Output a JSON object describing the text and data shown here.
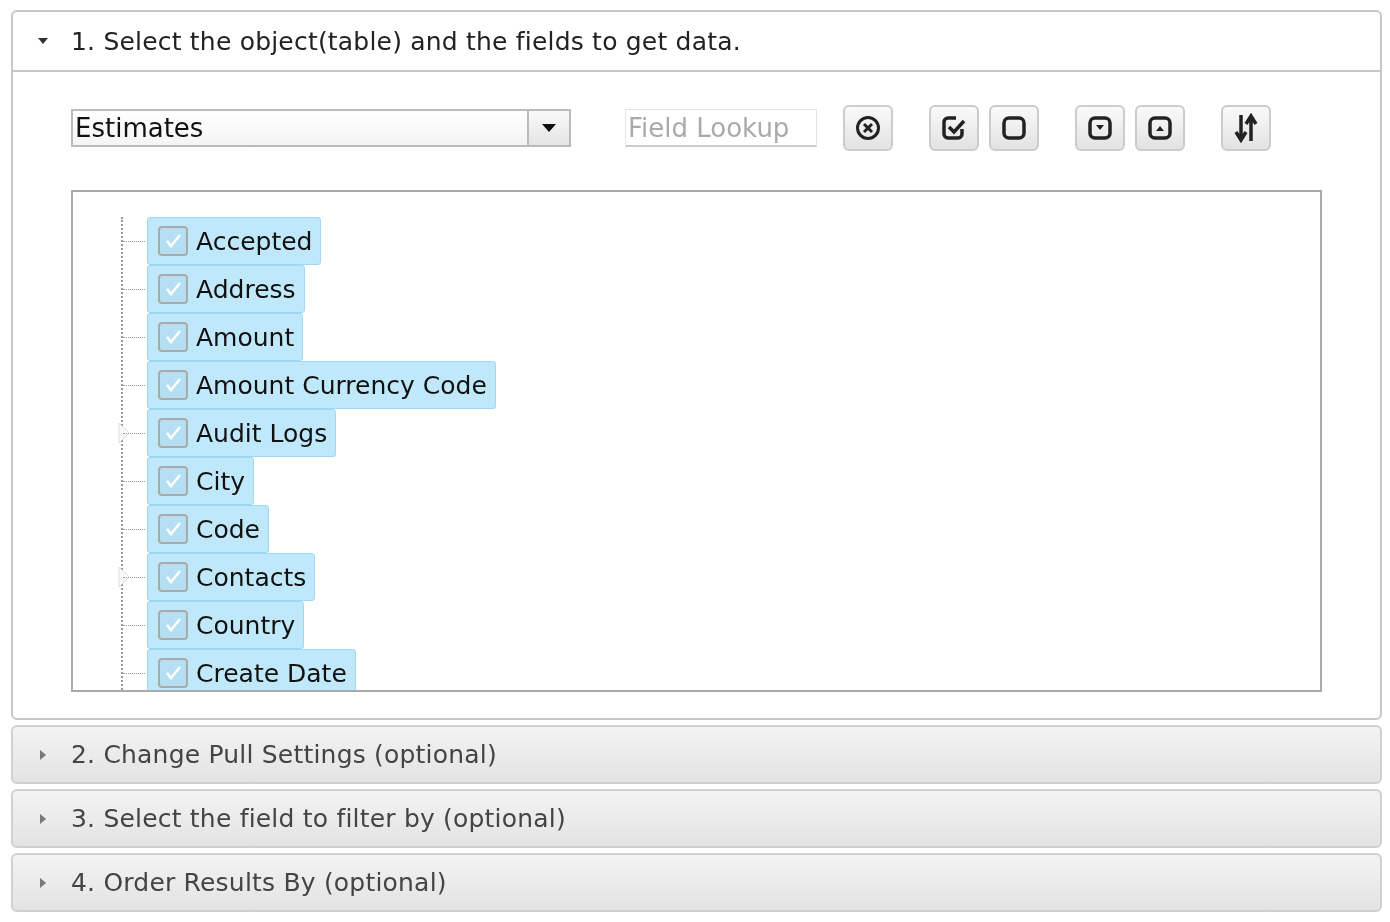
{
  "sections": [
    {
      "title": "1. Select the object(table) and the fields to get data.",
      "expanded": true
    },
    {
      "title": "2. Change Pull Settings (optional)",
      "expanded": false
    },
    {
      "title": "3. Select the field to filter by (optional)",
      "expanded": false
    },
    {
      "title": "4. Order Results By (optional)",
      "expanded": false
    }
  ],
  "object_select": {
    "value": "Estimates"
  },
  "field_lookup": {
    "placeholder": "Field Lookup"
  },
  "fields": [
    {
      "label": "Accepted",
      "checked": true,
      "selected": true,
      "has_children": false
    },
    {
      "label": "Address",
      "checked": true,
      "selected": true,
      "has_children": false
    },
    {
      "label": "Amount",
      "checked": true,
      "selected": true,
      "has_children": false
    },
    {
      "label": "Amount Currency Code",
      "checked": true,
      "selected": true,
      "has_children": false
    },
    {
      "label": "Audit Logs",
      "checked": true,
      "selected": true,
      "has_children": true
    },
    {
      "label": "City",
      "checked": true,
      "selected": true,
      "has_children": false
    },
    {
      "label": "Code",
      "checked": true,
      "selected": true,
      "has_children": false
    },
    {
      "label": "Contacts",
      "checked": true,
      "selected": true,
      "has_children": true
    },
    {
      "label": "Country",
      "checked": true,
      "selected": true,
      "has_children": false
    },
    {
      "label": "Create Date",
      "checked": true,
      "selected": true,
      "has_children": false
    }
  ]
}
